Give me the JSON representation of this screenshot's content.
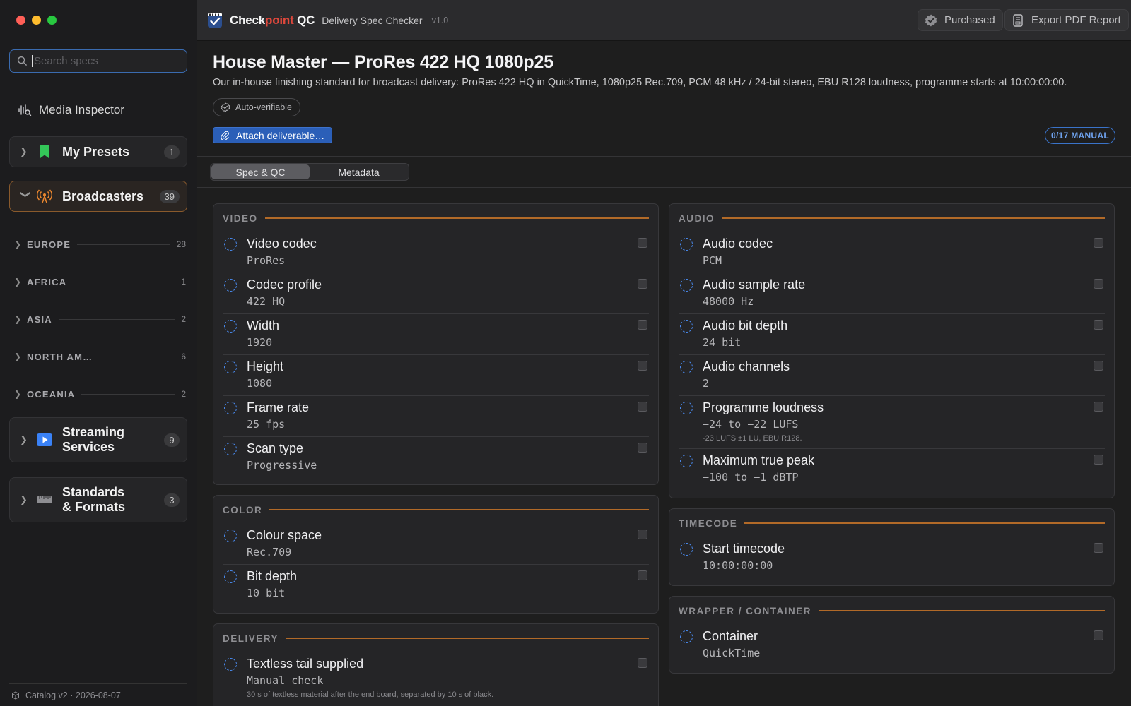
{
  "sidebar": {
    "search": {
      "placeholder": "Search specs",
      "value": ""
    },
    "media_inspector": {
      "label": "Media Inspector",
      "icon": "waveform-magnifier-icon"
    },
    "my_presets": {
      "label": "My Presets",
      "count": "1",
      "icon": "bookmark-icon",
      "color": "#34c759"
    },
    "broadcasters": {
      "label": "Broadcasters",
      "count": "39",
      "icon": "antenna-icon",
      "color": "#e8852e"
    },
    "regions": [
      {
        "name": "EUROPE",
        "count": "28"
      },
      {
        "name": "AFRICA",
        "count": "1"
      },
      {
        "name": "ASIA",
        "count": "2"
      },
      {
        "name": "NORTH AM…",
        "count": "6"
      },
      {
        "name": "OCEANIA",
        "count": "2"
      }
    ],
    "streaming": {
      "label_line1": "Streaming",
      "label_line2": "Services",
      "count": "9",
      "icon": "play-icon",
      "color": "#3a82f7"
    },
    "standards": {
      "label_line1": "Standards",
      "label_line2": "& Formats",
      "count": "3",
      "icon": "ruler-icon"
    },
    "footer": "Catalog v2 · 2026-08-07"
  },
  "toolbar": {
    "brand_part1": "Check",
    "brand_part2": "point",
    "brand_part3": " QC",
    "subtitle": "Delivery Spec Checker",
    "version": "v1.0",
    "purchased_label": "Purchased",
    "export_label": "Export PDF Report",
    "accent": "#e0483c"
  },
  "header": {
    "title": "House Master — ProRes 422 HQ 1080p25",
    "description": "Our in-house finishing standard for broadcast delivery: ProRes 422 HQ in QuickTime, 1080p25 Rec.709, PCM 48 kHz / 24-bit stereo, EBU R128 loudness, programme starts at 10:00:00:00.",
    "auto_verifiable": "Auto-verifiable",
    "attach_button": "Attach deliverable…",
    "manual_badge": "0/17 MANUAL"
  },
  "tabs": [
    {
      "label": "Spec & QC",
      "selected": true
    },
    {
      "label": "Metadata",
      "selected": false
    }
  ],
  "sections": {
    "video": {
      "title": "VIDEO",
      "rows": [
        {
          "name": "Video codec",
          "value": "ProRes"
        },
        {
          "name": "Codec profile",
          "value": "422 HQ"
        },
        {
          "name": "Width",
          "value": "1920"
        },
        {
          "name": "Height",
          "value": "1080"
        },
        {
          "name": "Frame rate",
          "value": "25 fps"
        },
        {
          "name": "Scan type",
          "value": "Progressive"
        }
      ]
    },
    "color": {
      "title": "COLOR",
      "rows": [
        {
          "name": "Colour space",
          "value": "Rec.709"
        },
        {
          "name": "Bit depth",
          "value": "10 bit"
        }
      ]
    },
    "delivery": {
      "title": "DELIVERY",
      "rows": [
        {
          "name": "Textless tail supplied",
          "value": "Manual check",
          "note": "30 s of textless material after the end board, separated by 10 s of black."
        }
      ]
    },
    "audio": {
      "title": "AUDIO",
      "rows": [
        {
          "name": "Audio codec",
          "value": "PCM"
        },
        {
          "name": "Audio sample rate",
          "value": "48000 Hz"
        },
        {
          "name": "Audio bit depth",
          "value": "24 bit"
        },
        {
          "name": "Audio channels",
          "value": "2"
        },
        {
          "name": "Programme loudness",
          "value": "−24 to −22 LUFS",
          "note": "-23 LUFS ±1 LU, EBU R128."
        },
        {
          "name": "Maximum true peak",
          "value": "−100 to −1 dBTP"
        }
      ]
    },
    "timecode": {
      "title": "TIMECODE",
      "rows": [
        {
          "name": "Start timecode",
          "value": "10:00:00:00"
        }
      ]
    },
    "wrapper": {
      "title": "WRAPPER / CONTAINER",
      "rows": [
        {
          "name": "Container",
          "value": "QuickTime"
        }
      ]
    }
  }
}
